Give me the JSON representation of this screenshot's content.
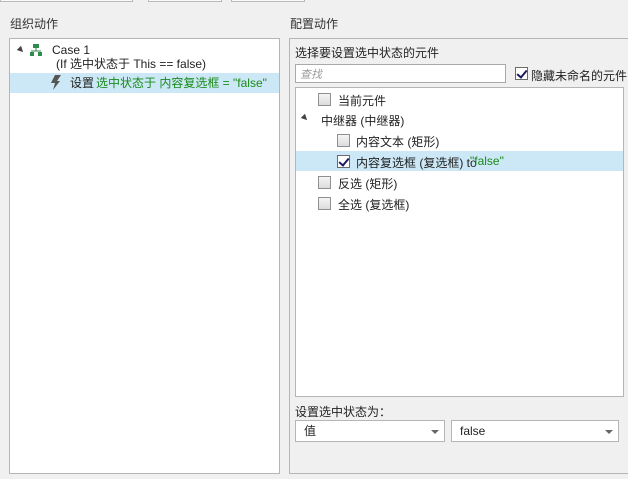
{
  "left": {
    "title": "组织动作",
    "case": {
      "name": "Case 1",
      "condition": "(If 选中状态于 This == false)"
    },
    "action": {
      "prefix": "设置 ",
      "detail": "选中状态于 内容复选框 = \"false\""
    }
  },
  "right": {
    "title": "配置动作",
    "select_label": "选择要设置选中状态的元件",
    "search_placeholder": "查找",
    "hide_unnamed_label": "隐藏未命名的元件",
    "hide_unnamed_checked": true,
    "widgets": [
      {
        "label": "当前元件",
        "checked": false
      },
      {
        "label": "中继器 (中继器)",
        "group": true
      },
      {
        "label": "内容文本 (矩形)",
        "checked": false
      },
      {
        "label": "内容复选框 (复选框) to ",
        "value": "\"false\"",
        "checked": true,
        "selected": true
      },
      {
        "label": "反选 (矩形)",
        "checked": false
      },
      {
        "label": "全选 (复选框)",
        "checked": false
      }
    ],
    "set_state_label": "设置选中状态为：",
    "value_type": "值",
    "value": "false"
  },
  "colors": {
    "selection": "#cce8f6",
    "green_text": "#1a8a1a"
  }
}
